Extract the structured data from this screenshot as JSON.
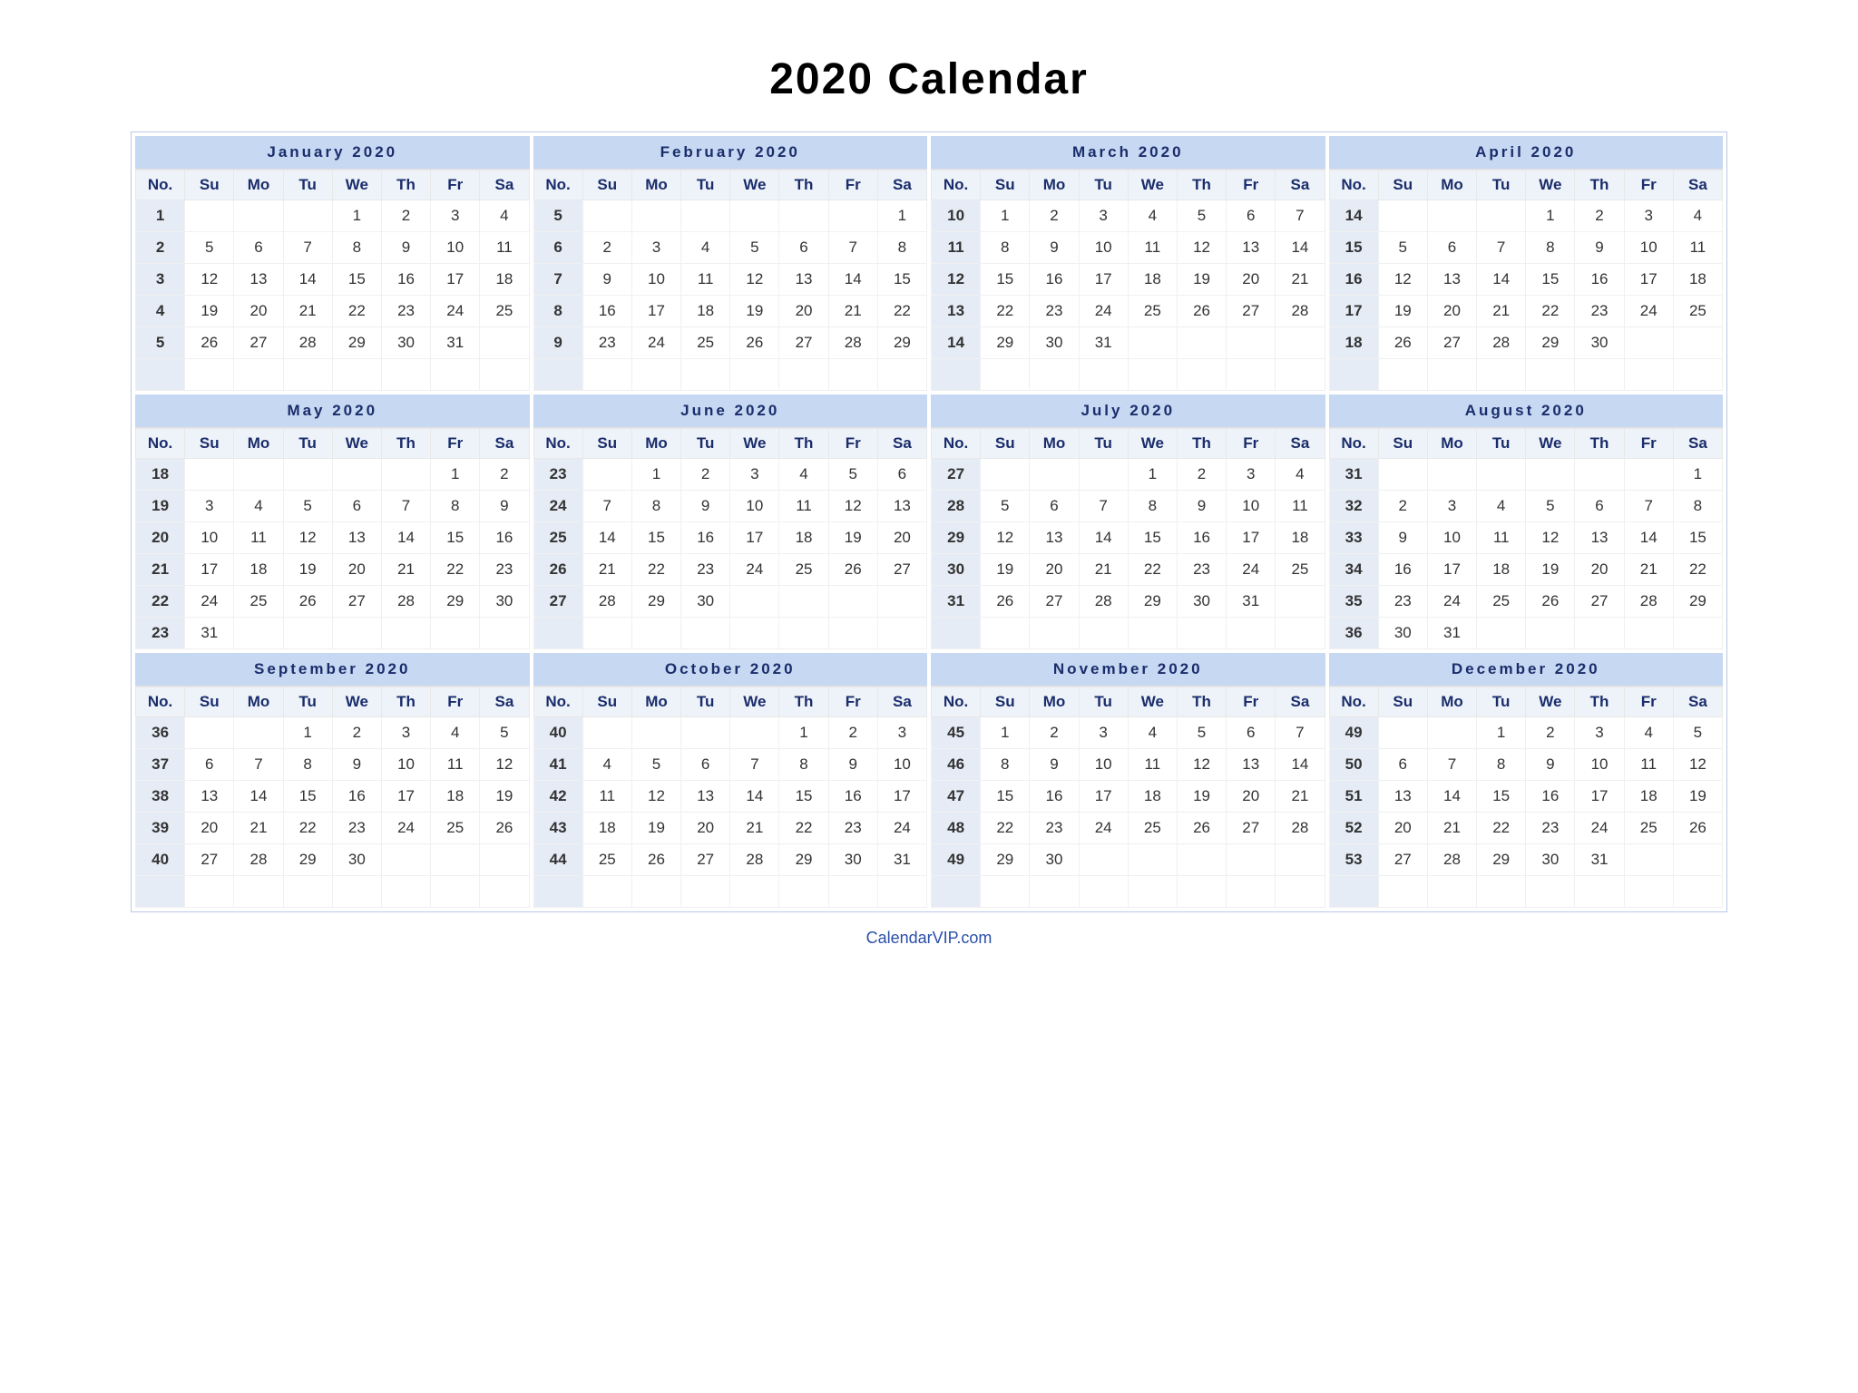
{
  "title": "2020 Calendar",
  "footer": "CalendarVIP.com",
  "weekday_headers": [
    "No.",
    "Su",
    "Mo",
    "Tu",
    "We",
    "Th",
    "Fr",
    "Sa"
  ],
  "months": [
    {
      "name": "January 2020",
      "weeks": [
        {
          "no": 1,
          "days": [
            "",
            "",
            "",
            "1",
            "2",
            "3",
            "4"
          ]
        },
        {
          "no": 2,
          "days": [
            "5",
            "6",
            "7",
            "8",
            "9",
            "10",
            "11"
          ]
        },
        {
          "no": 3,
          "days": [
            "12",
            "13",
            "14",
            "15",
            "16",
            "17",
            "18"
          ]
        },
        {
          "no": 4,
          "days": [
            "19",
            "20",
            "21",
            "22",
            "23",
            "24",
            "25"
          ]
        },
        {
          "no": 5,
          "days": [
            "26",
            "27",
            "28",
            "29",
            "30",
            "31",
            ""
          ]
        },
        {
          "no": "",
          "days": [
            "",
            "",
            "",
            "",
            "",
            "",
            ""
          ]
        }
      ]
    },
    {
      "name": "February 2020",
      "weeks": [
        {
          "no": 5,
          "days": [
            "",
            "",
            "",
            "",
            "",
            "",
            "1"
          ]
        },
        {
          "no": 6,
          "days": [
            "2",
            "3",
            "4",
            "5",
            "6",
            "7",
            "8"
          ]
        },
        {
          "no": 7,
          "days": [
            "9",
            "10",
            "11",
            "12",
            "13",
            "14",
            "15"
          ]
        },
        {
          "no": 8,
          "days": [
            "16",
            "17",
            "18",
            "19",
            "20",
            "21",
            "22"
          ]
        },
        {
          "no": 9,
          "days": [
            "23",
            "24",
            "25",
            "26",
            "27",
            "28",
            "29"
          ]
        },
        {
          "no": "",
          "days": [
            "",
            "",
            "",
            "",
            "",
            "",
            ""
          ]
        }
      ]
    },
    {
      "name": "March 2020",
      "weeks": [
        {
          "no": 10,
          "days": [
            "1",
            "2",
            "3",
            "4",
            "5",
            "6",
            "7"
          ]
        },
        {
          "no": 11,
          "days": [
            "8",
            "9",
            "10",
            "11",
            "12",
            "13",
            "14"
          ]
        },
        {
          "no": 12,
          "days": [
            "15",
            "16",
            "17",
            "18",
            "19",
            "20",
            "21"
          ]
        },
        {
          "no": 13,
          "days": [
            "22",
            "23",
            "24",
            "25",
            "26",
            "27",
            "28"
          ]
        },
        {
          "no": 14,
          "days": [
            "29",
            "30",
            "31",
            "",
            "",
            "",
            ""
          ]
        },
        {
          "no": "",
          "days": [
            "",
            "",
            "",
            "",
            "",
            "",
            ""
          ]
        }
      ]
    },
    {
      "name": "April 2020",
      "weeks": [
        {
          "no": 14,
          "days": [
            "",
            "",
            "",
            "1",
            "2",
            "3",
            "4"
          ]
        },
        {
          "no": 15,
          "days": [
            "5",
            "6",
            "7",
            "8",
            "9",
            "10",
            "11"
          ]
        },
        {
          "no": 16,
          "days": [
            "12",
            "13",
            "14",
            "15",
            "16",
            "17",
            "18"
          ]
        },
        {
          "no": 17,
          "days": [
            "19",
            "20",
            "21",
            "22",
            "23",
            "24",
            "25"
          ]
        },
        {
          "no": 18,
          "days": [
            "26",
            "27",
            "28",
            "29",
            "30",
            "",
            ""
          ]
        },
        {
          "no": "",
          "days": [
            "",
            "",
            "",
            "",
            "",
            "",
            ""
          ]
        }
      ]
    },
    {
      "name": "May 2020",
      "weeks": [
        {
          "no": 18,
          "days": [
            "",
            "",
            "",
            "",
            "",
            "1",
            "2"
          ]
        },
        {
          "no": 19,
          "days": [
            "3",
            "4",
            "5",
            "6",
            "7",
            "8",
            "9"
          ]
        },
        {
          "no": 20,
          "days": [
            "10",
            "11",
            "12",
            "13",
            "14",
            "15",
            "16"
          ]
        },
        {
          "no": 21,
          "days": [
            "17",
            "18",
            "19",
            "20",
            "21",
            "22",
            "23"
          ]
        },
        {
          "no": 22,
          "days": [
            "24",
            "25",
            "26",
            "27",
            "28",
            "29",
            "30"
          ]
        },
        {
          "no": 23,
          "days": [
            "31",
            "",
            "",
            "",
            "",
            "",
            ""
          ]
        }
      ]
    },
    {
      "name": "June 2020",
      "weeks": [
        {
          "no": 23,
          "days": [
            "",
            "1",
            "2",
            "3",
            "4",
            "5",
            "6"
          ]
        },
        {
          "no": 24,
          "days": [
            "7",
            "8",
            "9",
            "10",
            "11",
            "12",
            "13"
          ]
        },
        {
          "no": 25,
          "days": [
            "14",
            "15",
            "16",
            "17",
            "18",
            "19",
            "20"
          ]
        },
        {
          "no": 26,
          "days": [
            "21",
            "22",
            "23",
            "24",
            "25",
            "26",
            "27"
          ]
        },
        {
          "no": 27,
          "days": [
            "28",
            "29",
            "30",
            "",
            "",
            "",
            ""
          ]
        },
        {
          "no": "",
          "days": [
            "",
            "",
            "",
            "",
            "",
            "",
            ""
          ]
        }
      ]
    },
    {
      "name": "July 2020",
      "weeks": [
        {
          "no": 27,
          "days": [
            "",
            "",
            "",
            "1",
            "2",
            "3",
            "4"
          ]
        },
        {
          "no": 28,
          "days": [
            "5",
            "6",
            "7",
            "8",
            "9",
            "10",
            "11"
          ]
        },
        {
          "no": 29,
          "days": [
            "12",
            "13",
            "14",
            "15",
            "16",
            "17",
            "18"
          ]
        },
        {
          "no": 30,
          "days": [
            "19",
            "20",
            "21",
            "22",
            "23",
            "24",
            "25"
          ]
        },
        {
          "no": 31,
          "days": [
            "26",
            "27",
            "28",
            "29",
            "30",
            "31",
            ""
          ]
        },
        {
          "no": "",
          "days": [
            "",
            "",
            "",
            "",
            "",
            "",
            ""
          ]
        }
      ]
    },
    {
      "name": "August 2020",
      "weeks": [
        {
          "no": 31,
          "days": [
            "",
            "",
            "",
            "",
            "",
            "",
            "1"
          ]
        },
        {
          "no": 32,
          "days": [
            "2",
            "3",
            "4",
            "5",
            "6",
            "7",
            "8"
          ]
        },
        {
          "no": 33,
          "days": [
            "9",
            "10",
            "11",
            "12",
            "13",
            "14",
            "15"
          ]
        },
        {
          "no": 34,
          "days": [
            "16",
            "17",
            "18",
            "19",
            "20",
            "21",
            "22"
          ]
        },
        {
          "no": 35,
          "days": [
            "23",
            "24",
            "25",
            "26",
            "27",
            "28",
            "29"
          ]
        },
        {
          "no": 36,
          "days": [
            "30",
            "31",
            "",
            "",
            "",
            "",
            ""
          ]
        }
      ]
    },
    {
      "name": "September 2020",
      "weeks": [
        {
          "no": 36,
          "days": [
            "",
            "",
            "1",
            "2",
            "3",
            "4",
            "5"
          ]
        },
        {
          "no": 37,
          "days": [
            "6",
            "7",
            "8",
            "9",
            "10",
            "11",
            "12"
          ]
        },
        {
          "no": 38,
          "days": [
            "13",
            "14",
            "15",
            "16",
            "17",
            "18",
            "19"
          ]
        },
        {
          "no": 39,
          "days": [
            "20",
            "21",
            "22",
            "23",
            "24",
            "25",
            "26"
          ]
        },
        {
          "no": 40,
          "days": [
            "27",
            "28",
            "29",
            "30",
            "",
            "",
            ""
          ]
        },
        {
          "no": "",
          "days": [
            "",
            "",
            "",
            "",
            "",
            "",
            ""
          ]
        }
      ]
    },
    {
      "name": "October 2020",
      "weeks": [
        {
          "no": 40,
          "days": [
            "",
            "",
            "",
            "",
            "1",
            "2",
            "3"
          ]
        },
        {
          "no": 41,
          "days": [
            "4",
            "5",
            "6",
            "7",
            "8",
            "9",
            "10"
          ]
        },
        {
          "no": 42,
          "days": [
            "11",
            "12",
            "13",
            "14",
            "15",
            "16",
            "17"
          ]
        },
        {
          "no": 43,
          "days": [
            "18",
            "19",
            "20",
            "21",
            "22",
            "23",
            "24"
          ]
        },
        {
          "no": 44,
          "days": [
            "25",
            "26",
            "27",
            "28",
            "29",
            "30",
            "31"
          ]
        },
        {
          "no": "",
          "days": [
            "",
            "",
            "",
            "",
            "",
            "",
            ""
          ]
        }
      ]
    },
    {
      "name": "November 2020",
      "weeks": [
        {
          "no": 45,
          "days": [
            "1",
            "2",
            "3",
            "4",
            "5",
            "6",
            "7"
          ]
        },
        {
          "no": 46,
          "days": [
            "8",
            "9",
            "10",
            "11",
            "12",
            "13",
            "14"
          ]
        },
        {
          "no": 47,
          "days": [
            "15",
            "16",
            "17",
            "18",
            "19",
            "20",
            "21"
          ]
        },
        {
          "no": 48,
          "days": [
            "22",
            "23",
            "24",
            "25",
            "26",
            "27",
            "28"
          ]
        },
        {
          "no": 49,
          "days": [
            "29",
            "30",
            "",
            "",
            "",
            "",
            ""
          ]
        },
        {
          "no": "",
          "days": [
            "",
            "",
            "",
            "",
            "",
            "",
            ""
          ]
        }
      ]
    },
    {
      "name": "December 2020",
      "weeks": [
        {
          "no": 49,
          "days": [
            "",
            "",
            "1",
            "2",
            "3",
            "4",
            "5"
          ]
        },
        {
          "no": 50,
          "days": [
            "6",
            "7",
            "8",
            "9",
            "10",
            "11",
            "12"
          ]
        },
        {
          "no": 51,
          "days": [
            "13",
            "14",
            "15",
            "16",
            "17",
            "18",
            "19"
          ]
        },
        {
          "no": 52,
          "days": [
            "20",
            "21",
            "22",
            "23",
            "24",
            "25",
            "26"
          ]
        },
        {
          "no": 53,
          "days": [
            "27",
            "28",
            "29",
            "30",
            "31",
            "",
            ""
          ]
        },
        {
          "no": "",
          "days": [
            "",
            "",
            "",
            "",
            "",
            "",
            ""
          ]
        }
      ]
    }
  ]
}
